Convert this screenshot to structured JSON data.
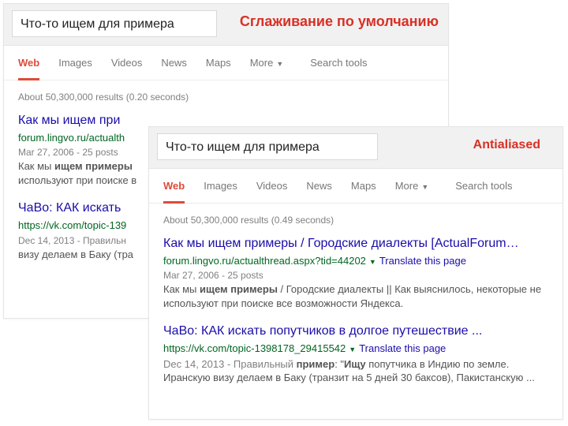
{
  "labels": {
    "back": "Сглаживание по умолчанию",
    "front": "Antialiased"
  },
  "search": {
    "query": "Что-то ищем для примера"
  },
  "tabs": {
    "web": "Web",
    "images": "Images",
    "videos": "Videos",
    "news": "News",
    "maps": "Maps",
    "more": "More",
    "search_tools": "Search tools"
  },
  "stats": {
    "back": "About 50,300,000 results (0.20 seconds)",
    "front": "About 50,300,000 results (0.49 seconds)"
  },
  "translate": "Translate this page",
  "back_results": [
    {
      "title": "Как мы ищем при",
      "url": "forum.lingvo.ru/actualth",
      "meta": "Mar 27, 2006 - 25 posts",
      "snip1": "Как мы ",
      "bold": "ищем примеры",
      "snip2": "используют при поиске в"
    },
    {
      "title": "ЧаВо: КАК искать",
      "url": "https://vk.com/topic-139",
      "meta": "Dec 14, 2013 - Правильн",
      "snip1": "визу делаем в Баку (тра",
      "bold": "",
      "snip2": ""
    }
  ],
  "front_results": [
    {
      "title": "Как мы ищем примеры / Городские диалекты [ActualForum…",
      "url": "forum.lingvo.ru/actualthread.aspx?tid=44202",
      "meta": "Mar 27, 2006 - 25 posts",
      "snip_pre": "Как мы ",
      "bold": "ищем примеры",
      "snip_post": " / Городские диалекты || Как выяснилось, некоторые не используют при поиске все возможности Яндекса."
    },
    {
      "title": "ЧаВо: КАК искать попутчиков в долгое путешествие ...",
      "url": "https://vk.com/topic-1398178_29415542",
      "snip_pre": "Dec 14, 2013 - Правильный ",
      "bold1": "пример",
      "mid": ": \"",
      "bold2": "Ищу",
      "snip_post": " попутчика в Индию по земле. Иранскую визу делаем в Баку (транзит на 5 дней 30 баксов), Пакистанскую ..."
    }
  ]
}
